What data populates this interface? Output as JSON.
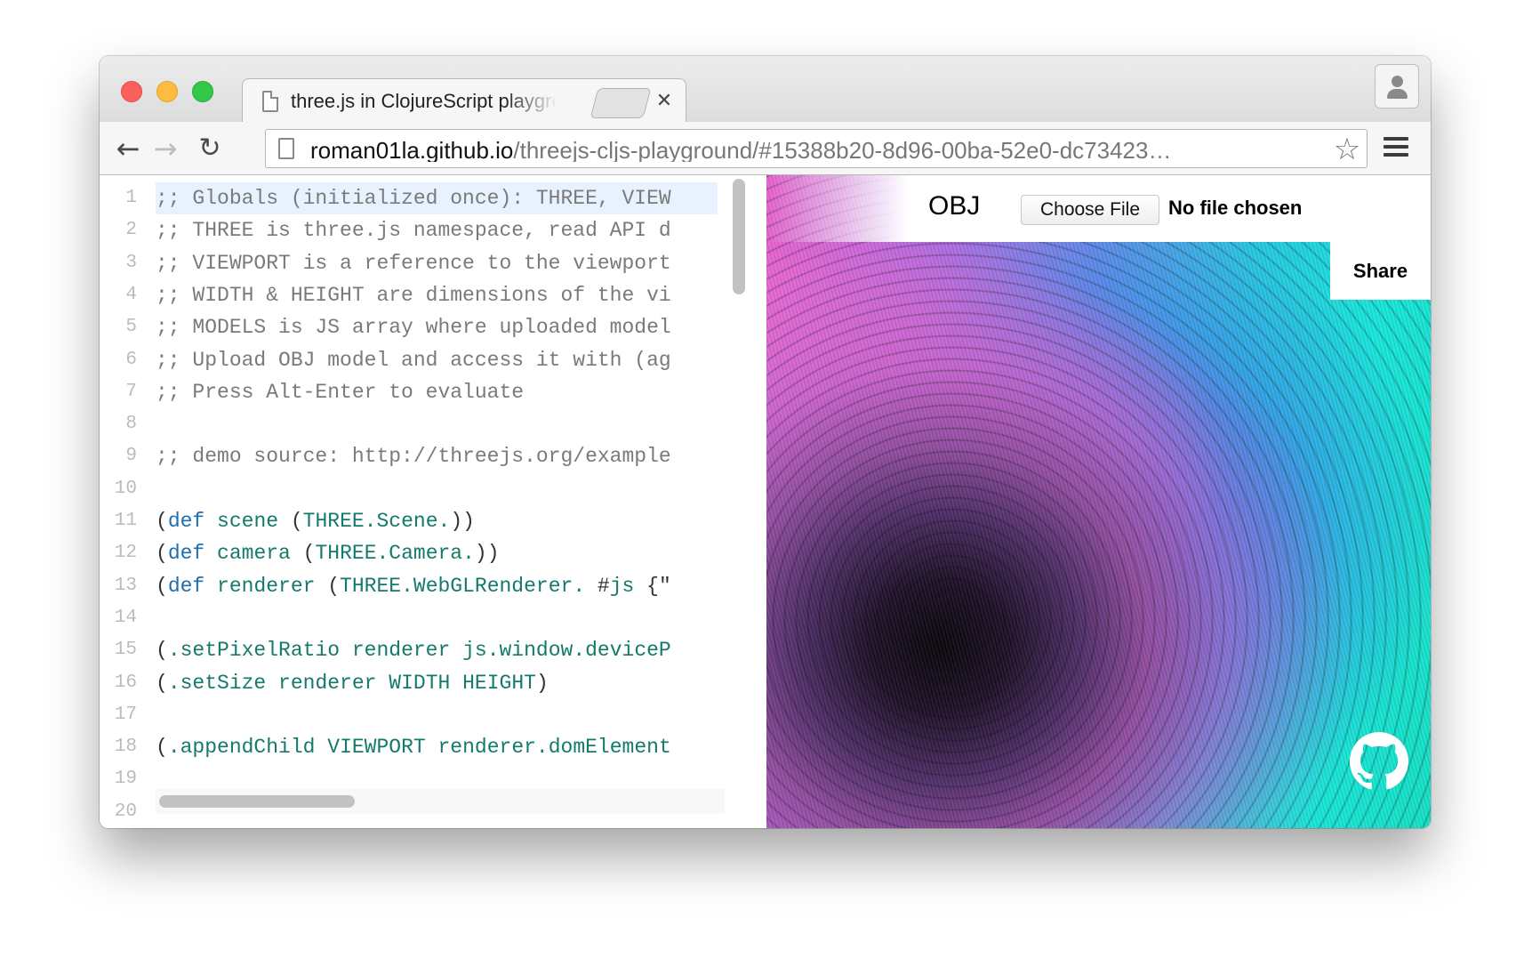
{
  "tab": {
    "title": "three.js in ClojureScript playground",
    "close_glyph": "✕"
  },
  "toolbar": {
    "back_glyph": "←",
    "forward_glyph": "→",
    "reload_glyph": "↻",
    "url_host": "roman01la.github.io",
    "url_path": "/threejs-cljs-playground/#15388b20-8d96-00ba-52e0-dc73423…",
    "star_glyph": "☆"
  },
  "editor": {
    "line_numbers": [
      "1",
      "2",
      "3",
      "4",
      "5",
      "6",
      "7",
      "8",
      "9",
      "10",
      "11",
      "12",
      "13",
      "14",
      "15",
      "16",
      "17",
      "18",
      "19",
      "20"
    ],
    "lines": [
      ";; Globals (initialized once): THREE, VIEW",
      ";; THREE is three.js namespace, read API d",
      ";; VIEWPORT is a reference to the viewport",
      ";; WIDTH & HEIGHT are dimensions of the vi",
      ";; MODELS is JS array where uploaded model",
      ";; Upload OBJ model and access it with (ag",
      ";; Press Alt-Enter to evaluate",
      "",
      ";; demo source: http://threejs.org/example",
      "",
      "(def scene (THREE.Scene.))",
      "(def camera (THREE.Camera.))",
      "(def renderer (THREE.WebGLRenderer. #js {\"",
      "",
      "(.setPixelRatio renderer js.window.deviceP",
      "(.setSize renderer WIDTH HEIGHT)",
      "",
      "(.appendChild VIEWPORT renderer.domElement",
      "",
      ""
    ]
  },
  "viewport": {
    "obj_label": "OBJ",
    "choose_file_label": "Choose File",
    "file_status": "No file chosen",
    "share_label": "Share"
  },
  "colors": {
    "comment": "#7a7a7a",
    "keyword": "#1f6fb0",
    "variable": "#147a6b",
    "active_line": "#e8f2fe"
  },
  "icons": [
    "document-icon",
    "close-icon",
    "profile-icon",
    "back-arrow-icon",
    "forward-arrow-icon",
    "reload-icon",
    "page-icon",
    "star-icon",
    "menu-icon",
    "github-icon"
  ]
}
